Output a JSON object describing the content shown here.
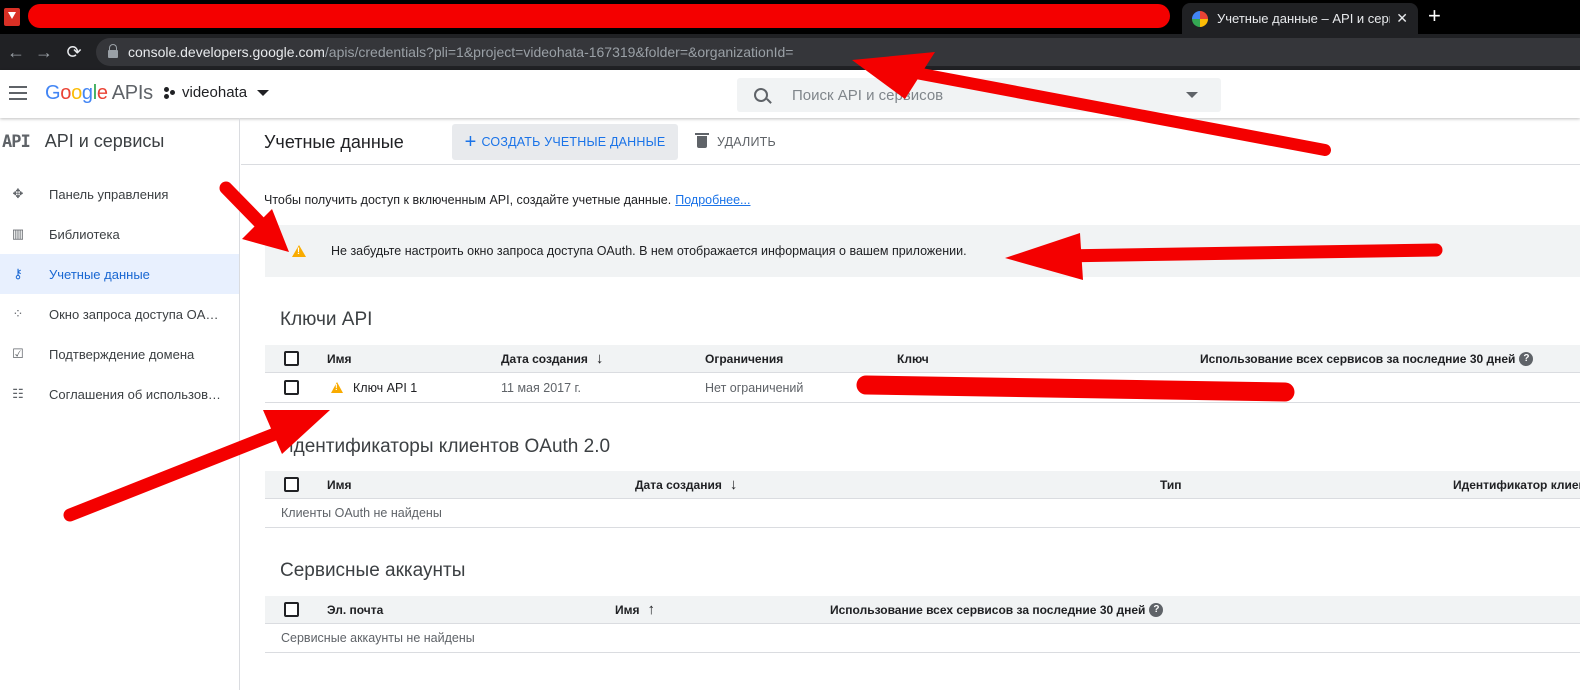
{
  "browser": {
    "tab_title": "Учетные данные – API и сервисы",
    "url_host": "console.developers.google.com",
    "url_path": "/apis/credentials?pli=1&project=videohata-167319&folder=&organizationId="
  },
  "header": {
    "logo_g": "G",
    "logo_o1": "o",
    "logo_o2": "o",
    "logo_g2": "g",
    "logo_l": "l",
    "logo_e": "e",
    "logo_apis": "APIs",
    "project_name": "videohata",
    "search_placeholder": "Поиск API и сервисов"
  },
  "sidebar": {
    "badge": "API",
    "title": "API и сервисы",
    "items": [
      {
        "label": "Панель управления",
        "icon": "dashboard-icon"
      },
      {
        "label": "Библиотека",
        "icon": "library-icon"
      },
      {
        "label": "Учетные данные",
        "icon": "key-icon"
      },
      {
        "label": "Окно запроса доступа OAuth",
        "icon": "consent-icon"
      },
      {
        "label": "Подтверждение домена",
        "icon": "domain-check-icon"
      },
      {
        "label": "Соглашения об использовании страниц",
        "icon": "agreements-icon"
      }
    ]
  },
  "toolbar": {
    "title": "Учетные данные",
    "create_label": "СОЗДАТЬ УЧЕТНЫЕ ДАННЫЕ",
    "delete_label": "УДАЛИТЬ"
  },
  "info": {
    "text": "Чтобы получить доступ к включенным API, создайте учетные данные.",
    "link": "Подробнее..."
  },
  "warning": {
    "text": "Не забудьте настроить окно запроса доступа OAuth. В нем отображается информация о вашем приложении."
  },
  "api_keys": {
    "title": "Ключи API",
    "columns": {
      "name": "Имя",
      "created": "Дата создания",
      "restrictions": "Ограничения",
      "key": "Ключ",
      "usage": "Использование всех сервисов за последние 30 дней"
    },
    "rows": [
      {
        "name": "Ключ API 1",
        "created": "11 мая 2017 г.",
        "restrictions": "Нет ограничений"
      }
    ]
  },
  "oauth": {
    "title": "Идентификаторы клиентов OAuth 2.0",
    "columns": {
      "name": "Имя",
      "created": "Дата создания",
      "type": "Тип",
      "client_id": "Идентификатор клиента"
    },
    "empty": "Клиенты OAuth не найдены"
  },
  "service_accounts": {
    "title": "Сервисные аккаунты",
    "columns": {
      "email": "Эл. почта",
      "name": "Имя",
      "usage": "Использование всех сервисов за последние 30 дней"
    },
    "empty": "Сервисные аккаунты не найдены"
  },
  "colors": {
    "accent": "#1a73e8",
    "warning": "#f9ab00",
    "annotation": "#f40000"
  }
}
